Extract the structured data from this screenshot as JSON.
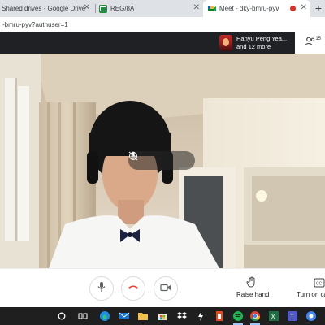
{
  "browser": {
    "tabs": [
      {
        "label": "Shared drives - Google Drive"
      },
      {
        "label": "REG/8A"
      },
      {
        "label": "Meet - dky-bmru-pyv"
      }
    ],
    "address": "-bmru-pyv?authuser=1"
  },
  "meet": {
    "participant_name": "Hanyu Peng Yea...",
    "participant_more": "and 12 more",
    "people_count": "15",
    "controls": {
      "raise_hand_label": "Raise hand",
      "turn_on_captions_label": "Turn on ca"
    }
  },
  "colors": {
    "end_call": "#ea4335",
    "meet_dark": "#202124",
    "recording": "#d93025"
  },
  "icons": {
    "mic": "mic-icon",
    "end_call": "end-call-icon",
    "camera": "camera-icon",
    "raise_hand": "hand-icon",
    "captions": "captions-icon",
    "pin": "pin-icon",
    "mute": "mic-off-icon",
    "remove": "remove-icon"
  }
}
